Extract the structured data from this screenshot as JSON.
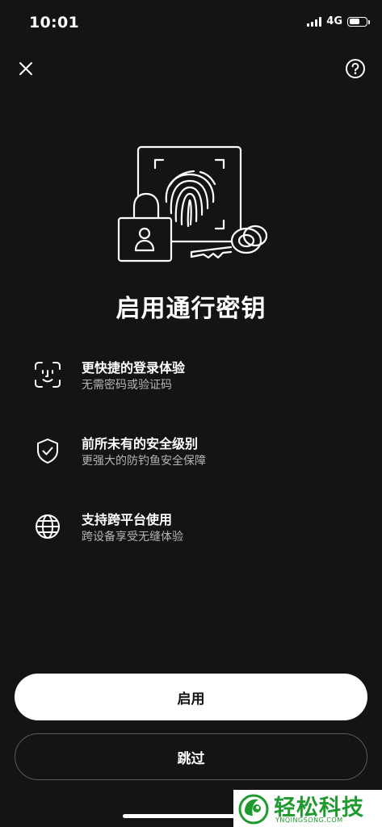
{
  "status_bar": {
    "time": "10:01",
    "network": "4G",
    "battery_level": 0.6,
    "signal_icon": "signal-icon",
    "battery_icon": "battery-icon"
  },
  "top_bar": {
    "close_icon": "close-icon",
    "help_icon": "help-icon"
  },
  "hero": {
    "icon": "passkey-illustration-icon"
  },
  "title": "启用通行密钥",
  "features": [
    {
      "icon": "face-id-icon",
      "title": "更快捷的登录体验",
      "subtitle": "无需密码或验证码"
    },
    {
      "icon": "shield-check-icon",
      "title": "前所未有的安全级别",
      "subtitle": "更强大的防钓鱼安全保障"
    },
    {
      "icon": "globe-icon",
      "title": "支持跨平台使用",
      "subtitle": "跨设备享受无缝体验"
    }
  ],
  "actions": {
    "enable_label": "启用",
    "skip_label": "跳过"
  },
  "watermark": {
    "text": "轻松科技",
    "url": "YNQINGSONG.COM"
  },
  "colors": {
    "background": "#141414",
    "primary_button": "#ffffff",
    "secondary_border": "#5a5a5a",
    "subtitle_text": "#b4b4b4",
    "watermark_green": "#1f9a2f"
  }
}
